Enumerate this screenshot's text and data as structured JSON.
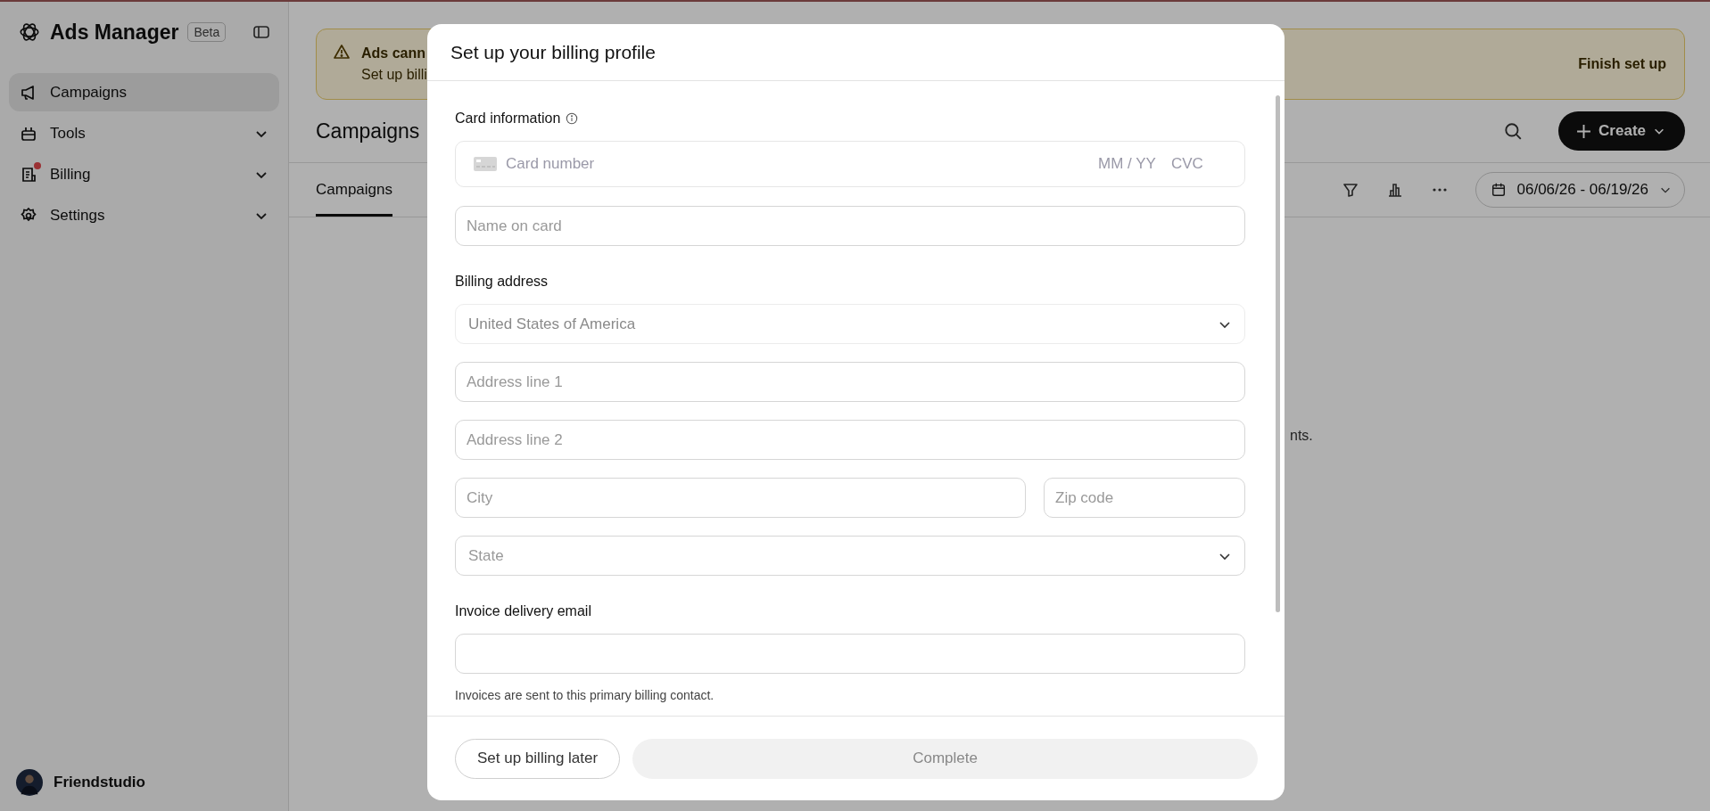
{
  "sidebar": {
    "title": "Ads Manager",
    "badge": "Beta",
    "items": [
      {
        "label": "Campaigns",
        "selected": true,
        "expandable": false,
        "alert": false
      },
      {
        "label": "Tools",
        "selected": false,
        "expandable": true,
        "alert": false
      },
      {
        "label": "Billing",
        "selected": false,
        "expandable": true,
        "alert": true
      },
      {
        "label": "Settings",
        "selected": false,
        "expandable": true,
        "alert": false
      }
    ],
    "user": {
      "name": "Friendstudio"
    }
  },
  "banner": {
    "title": "Ads cann",
    "text": "Set up billi",
    "action": "Finish set up"
  },
  "page": {
    "title": "Campaigns",
    "create_button": "Create",
    "tabs": [
      {
        "label": "Campaigns",
        "selected": true
      }
    ],
    "date_range": "06/06/26 - 06/19/26",
    "empty_text": "nts."
  },
  "modal": {
    "title": "Set up your billing profile",
    "form": [
      {
        "kind": "label",
        "text": "Card information",
        "info": true
      },
      {
        "kind": "card",
        "placeholder": "Card number",
        "expiry_placeholder": "MM / YY",
        "cvc_placeholder": "CVC"
      },
      {
        "kind": "input",
        "placeholder": "Name on card"
      },
      {
        "kind": "label",
        "text": "Billing address",
        "info": false
      },
      {
        "kind": "select",
        "value": "United States of America",
        "disabled": true
      },
      {
        "kind": "input",
        "placeholder": "Address line 1"
      },
      {
        "kind": "input",
        "placeholder": "Address line 2"
      },
      {
        "kind": "pair",
        "fields": [
          {
            "placeholder": "City"
          },
          {
            "placeholder": "Zip code"
          }
        ]
      },
      {
        "kind": "select",
        "placeholder": "State",
        "disabled": false
      },
      {
        "kind": "label",
        "text": "Invoice delivery email",
        "info": false
      },
      {
        "kind": "input"
      },
      {
        "kind": "hint",
        "text": "Invoices are sent to this primary billing contact."
      }
    ],
    "buttons": [
      {
        "label": "Set up billing later",
        "kind": "secondary",
        "disabled": false
      },
      {
        "label": "Complete",
        "kind": "primary",
        "disabled": true
      }
    ]
  }
}
